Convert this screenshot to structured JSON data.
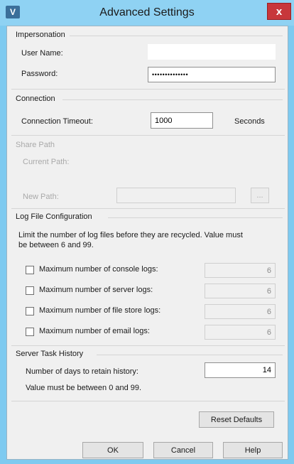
{
  "window": {
    "title": "Advanced Settings",
    "icon": "app-icon",
    "close_glyph": "x"
  },
  "impersonation": {
    "section_label": "Impersonation",
    "user_name_label": "User Name:",
    "user_name_value": "",
    "password_label": "Password:",
    "password_value": "••••••••••••••"
  },
  "connection": {
    "section_label": "Connection",
    "timeout_label": "Connection Timeout:",
    "timeout_value": "1000",
    "unit_label": "Seconds"
  },
  "share_path": {
    "section_label": "Share Path",
    "current_path_label": "Current Path:",
    "new_path_label": "New Path:",
    "new_path_value": "",
    "browse_label": "..."
  },
  "log_files": {
    "section_label": "Log File Configuration",
    "description_line1": "Limit the number of log files before they are recycled. Value must",
    "description_line2": "be between 6 and 99.",
    "items": [
      {
        "label": "Maximum number of console logs:",
        "checked": false,
        "value": "6"
      },
      {
        "label": "Maximum number of server logs:",
        "checked": false,
        "value": "6"
      },
      {
        "label": "Maximum number of file store logs:",
        "checked": false,
        "value": "6"
      },
      {
        "label": "Maximum number of email logs:",
        "checked": false,
        "value": "6"
      }
    ]
  },
  "server_task_history": {
    "section_label": "Server Task History",
    "days_label": "Number of days to retain history:",
    "days_value": "14",
    "hint": "Value must be between 0 and 99."
  },
  "buttons": {
    "reset_defaults": "Reset Defaults",
    "ok": "OK",
    "cancel": "Cancel",
    "help": "Help"
  }
}
